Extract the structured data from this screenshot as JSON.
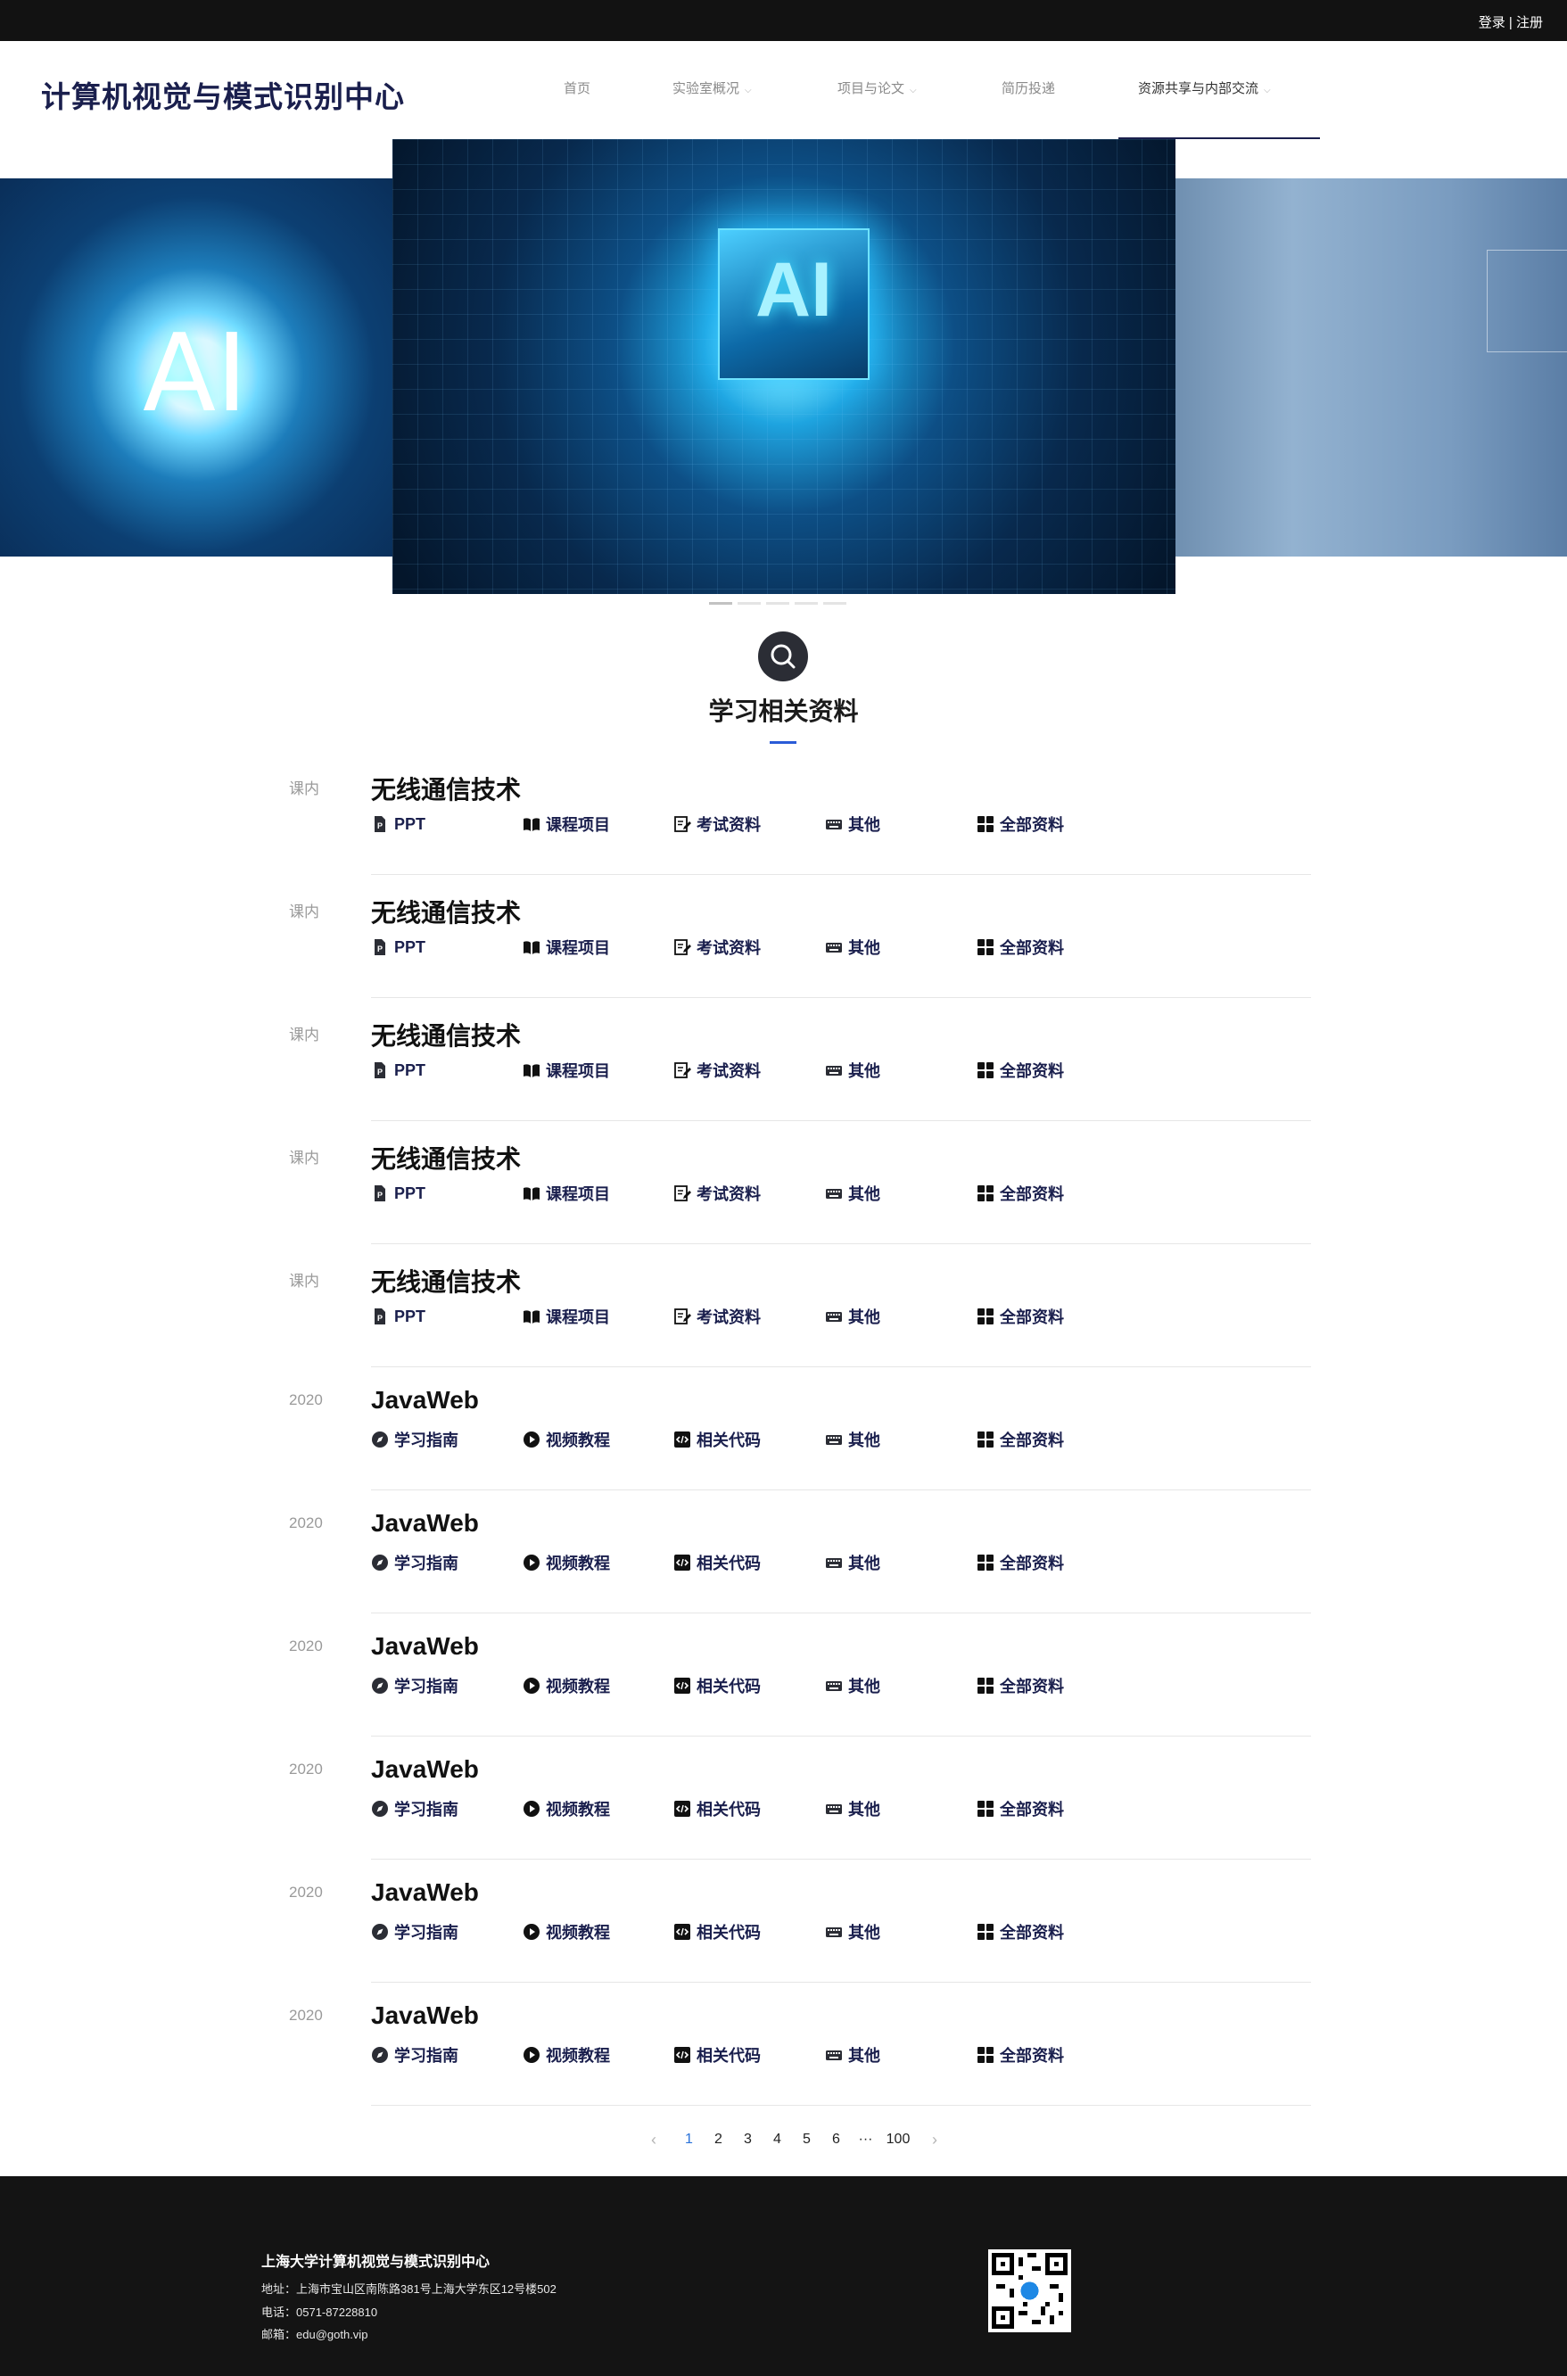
{
  "topbar": {
    "login": "登录",
    "separator": " | ",
    "register": "注册"
  },
  "header": {
    "title": "计算机视觉与模式识别中心"
  },
  "nav": [
    {
      "label": "首页",
      "dropdown": false
    },
    {
      "label": "实验室概况",
      "dropdown": true
    },
    {
      "label": "项目与论文",
      "dropdown": true
    },
    {
      "label": "简历投递",
      "dropdown": false
    },
    {
      "label": "资源共享与内部交流",
      "dropdown": true,
      "active": true
    }
  ],
  "banner": {
    "center_text": "AI",
    "left_text": "AI",
    "slides": 5,
    "active_slide": 0
  },
  "section": {
    "title": "学习相关资料",
    "icon": "search-icon",
    "accent": "#2a5bd7"
  },
  "course_links": [
    {
      "label": "PPT",
      "icon": "ppt-file-icon"
    },
    {
      "label": "课程项目",
      "icon": "book-icon"
    },
    {
      "label": "考试资料",
      "icon": "edit-icon"
    },
    {
      "label": "其他",
      "icon": "keyboard-icon"
    },
    {
      "label": "全部资料",
      "icon": "grid-icon"
    }
  ],
  "web_links": [
    {
      "label": "学习指南",
      "icon": "compass-icon"
    },
    {
      "label": "视频教程",
      "icon": "play-icon"
    },
    {
      "label": "相关代码",
      "icon": "code-icon"
    },
    {
      "label": "其他",
      "icon": "keyboard-icon"
    },
    {
      "label": "全部资料",
      "icon": "grid-icon"
    }
  ],
  "items": [
    {
      "tag": "课内",
      "title": "无线通信技术",
      "kind": "course"
    },
    {
      "tag": "课内",
      "title": "无线通信技术",
      "kind": "course"
    },
    {
      "tag": "课内",
      "title": "无线通信技术",
      "kind": "course"
    },
    {
      "tag": "课内",
      "title": "无线通信技术",
      "kind": "course"
    },
    {
      "tag": "课内",
      "title": "无线通信技术",
      "kind": "course"
    },
    {
      "tag": "2020",
      "title": "JavaWeb",
      "kind": "web"
    },
    {
      "tag": "2020",
      "title": "JavaWeb",
      "kind": "web"
    },
    {
      "tag": "2020",
      "title": "JavaWeb",
      "kind": "web"
    },
    {
      "tag": "2020",
      "title": "JavaWeb",
      "kind": "web"
    },
    {
      "tag": "2020",
      "title": "JavaWeb",
      "kind": "web"
    },
    {
      "tag": "2020",
      "title": "JavaWeb",
      "kind": "web"
    }
  ],
  "pagination": {
    "prev": "‹",
    "pages": [
      "1",
      "2",
      "3",
      "4",
      "5",
      "6"
    ],
    "ellipsis": "···",
    "last": "100",
    "next": "›",
    "current": "1"
  },
  "footer": {
    "org": "上海大学计算机视觉与模式识别中心",
    "address": "地址：上海市宝山区南陈路381号上海大学东区12号楼502",
    "phone": "电话：0571-87228810",
    "email": "邮箱：edu@goth.vip"
  }
}
